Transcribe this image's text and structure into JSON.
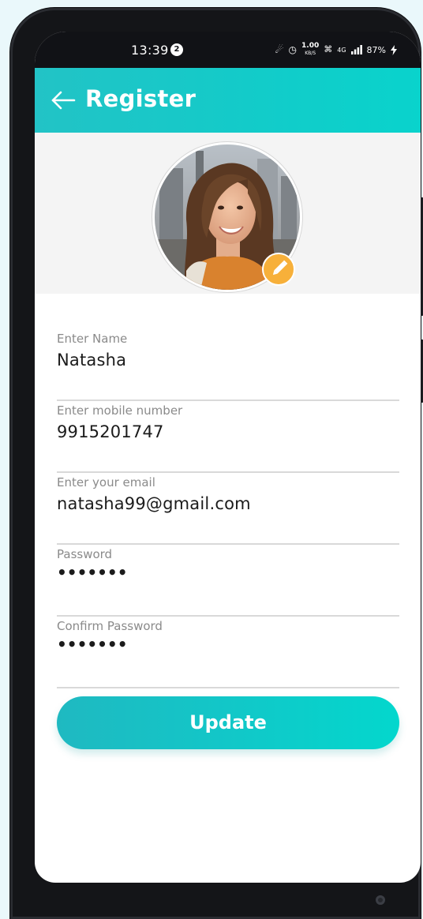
{
  "status_bar": {
    "time": "13:39",
    "notification_count": "2",
    "speed": "1.00",
    "speed_unit": "KB/S",
    "network": "4G",
    "battery": "87%"
  },
  "app_bar": {
    "title": "Register",
    "back_icon": "arrow-left-icon"
  },
  "profile": {
    "avatar_alt": "profile photo",
    "edit_icon": "pencil-icon",
    "edit_badge_color": "#f7b03a"
  },
  "form": {
    "fields": [
      {
        "label": "Enter Name",
        "value": "Natasha"
      },
      {
        "label": "Enter mobile number",
        "value": "9915201747"
      },
      {
        "label": "Enter your email",
        "value": "natasha99@gmail.com"
      },
      {
        "label": "Password",
        "value": "•••••••"
      },
      {
        "label": "Confirm Password",
        "value": "•••••••"
      }
    ],
    "submit_label": "Update"
  },
  "colors": {
    "accent_start": "#22c3c6",
    "accent_end": "#09d3cc",
    "avatar_section_bg": "#f4f4f4"
  }
}
